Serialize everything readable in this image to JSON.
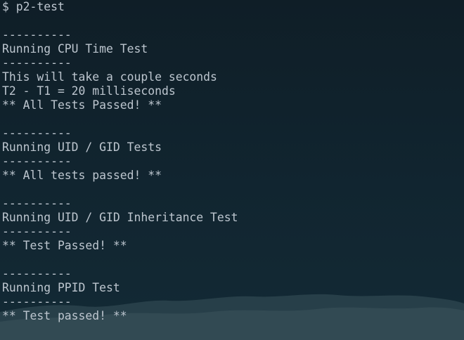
{
  "terminal": {
    "lines": [
      "$ p2-test",
      "",
      "----------",
      "Running CPU Time Test",
      "----------",
      "This will take a couple seconds",
      "T2 - T1 = 20 milliseconds",
      "** All Tests Passed! **",
      "",
      "----------",
      "Running UID / GID Tests",
      "----------",
      "** All tests passed! **",
      "",
      "----------",
      "Running UID / GID Inheritance Test",
      "----------",
      "** Test Passed! **",
      "",
      "----------",
      "Running PPID Test",
      "----------",
      "** Test passed! **"
    ]
  },
  "colors": {
    "background": "#0f1e27",
    "text": "#bdc6cf",
    "wave": "#2f4650"
  }
}
